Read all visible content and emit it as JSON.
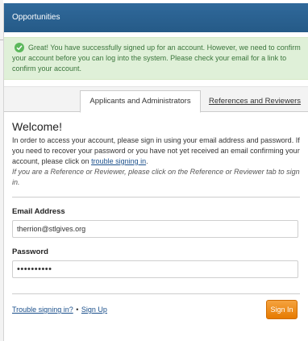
{
  "header": {
    "title": "Opportunities"
  },
  "alert": {
    "message": "Great! You have successfully signed up for an account. However, we need to confirm your account before you can log into the system. Please check your email for a link to confirm your account."
  },
  "tabs": [
    {
      "label": "Applicants and Administrators",
      "active": true
    },
    {
      "label": "References and Reviewers",
      "active": false
    }
  ],
  "main": {
    "heading": "Welcome!",
    "intro_text": "In order to access your account, please sign in using your email address and password. If you need to recover your password or you have not yet received an email confirming your account, please click on ",
    "intro_link": "trouble signing in",
    "intro_end": ".",
    "note": "If you are a Reference or Reviewer, please click on the Reference or Reviewer tab to sign in."
  },
  "form": {
    "email_label": "Email Address",
    "email_value": "therrion@stlgives.org",
    "password_label": "Password",
    "password_value": "••••••••••"
  },
  "footer": {
    "trouble_link": "Trouble signing in?",
    "separator": "•",
    "signup_link": "Sign Up",
    "signin_button": "Sign In"
  },
  "colors": {
    "header_bg": "#2a6496",
    "alert_bg": "#dff0d8",
    "alert_text": "#3c763d",
    "button_bg": "#f0880a",
    "link": "#1a4f8b"
  }
}
